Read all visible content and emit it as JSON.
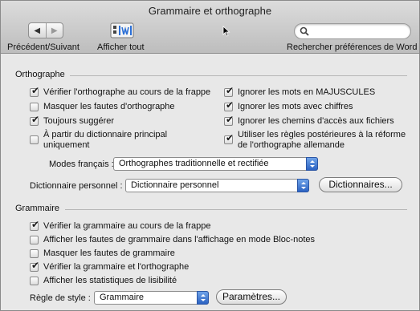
{
  "window": {
    "title": "Grammaire et orthographe"
  },
  "toolbar": {
    "nav_label": "Précédent/Suivant",
    "show_all_label": "Afficher tout",
    "search_label": "Rechercher préférences de Word",
    "back_icon": "back-arrow-icon",
    "forward_icon": "forward-arrow-icon"
  },
  "orthographe": {
    "title": "Orthographe",
    "options_left": [
      {
        "label": "Vérifier l'orthographe au cours de la frappe",
        "checked": true
      },
      {
        "label": "Masquer les fautes d'orthographe",
        "checked": false
      },
      {
        "label": "Toujours suggérer",
        "checked": true
      },
      {
        "label": "À partir du dictionnaire principal\nuniquement",
        "checked": false
      }
    ],
    "options_right": [
      {
        "label": "Ignorer les mots en MAJUSCULES",
        "checked": true
      },
      {
        "label": "Ignorer les mots avec chiffres",
        "checked": true
      },
      {
        "label": "Ignorer les chemins d'accès aux fichiers",
        "checked": true
      },
      {
        "label": "Utiliser les règles postérieures à la réforme\nde l'orthographe allemande",
        "checked": true
      }
    ],
    "modes_label": "Modes français :",
    "modes_value": "Orthographes traditionnelle et rectifiée",
    "dict_label": "Dictionnaire personnel :",
    "dict_value": "Dictionnaire personnel",
    "dict_button": "Dictionnaires..."
  },
  "grammaire": {
    "title": "Grammaire",
    "options": [
      {
        "label": "Vérifier la grammaire au cours de la frappe",
        "checked": true
      },
      {
        "label": "Afficher les fautes de grammaire dans l'affichage en mode Bloc-notes",
        "checked": false
      },
      {
        "label": "Masquer les fautes de grammaire",
        "checked": false
      },
      {
        "label": "Vérifier la grammaire et l'orthographe",
        "checked": true
      },
      {
        "label": "Afficher les statistiques de lisibilité",
        "checked": false
      }
    ],
    "style_label": "Règle de style :",
    "style_value": "Grammaire",
    "settings_button": "Paramètres..."
  }
}
